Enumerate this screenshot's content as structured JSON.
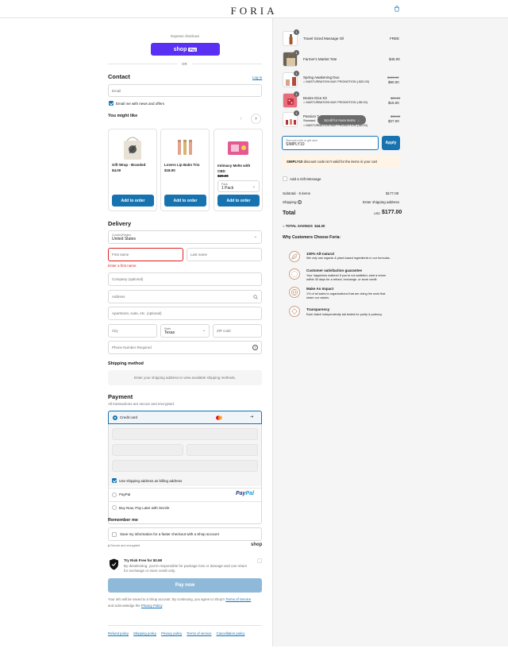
{
  "brand": {
    "logo": "FORIA"
  },
  "express": {
    "label": "Express checkout",
    "shop_pay_label": "shop",
    "shop_pay_badge": "Pay",
    "or": "OR"
  },
  "contact": {
    "title": "Contact",
    "login": "Log in",
    "email_placeholder": "Email",
    "news_label": "Email me with news and offers"
  },
  "upsell": {
    "title": "You might like",
    "items": [
      {
        "name": "Gift Wrap - Branded",
        "price": "$4.00",
        "button": "Add to order"
      },
      {
        "name": "Lovers Lip Balm Trio",
        "price": "$18.00",
        "button": "Add to order"
      },
      {
        "name": "Intimacy Melts with CBD",
        "price": "$20.00",
        "pack_label": "Pack",
        "pack_value": "1 Pack",
        "button": "Add to order"
      }
    ]
  },
  "delivery": {
    "title": "Delivery",
    "country_label": "Country/Region",
    "country_value": "United States",
    "first_name": "First name",
    "last_name": "Last name",
    "error": "Enter a first name",
    "company": "Company (optional)",
    "address": "Address",
    "apartment": "Apartment, suite, etc. (optional)",
    "city": "City",
    "state_label": "State",
    "state_value": "Texas",
    "zip": "ZIP code",
    "phone": "Phone Number Required"
  },
  "shipping": {
    "title": "Shipping method",
    "note": "Enter your shipping address to view available shipping methods."
  },
  "payment": {
    "title": "Payment",
    "subtitle": "All transactions are secure and encrypted.",
    "credit_card": "Credit card",
    "billing_same": "Use shipping address as billing address",
    "paypal": "PayPal",
    "paypal_logo_a": "Pay",
    "paypal_logo_b": "Pal",
    "sezzle": "Buy Now, Pay Later with Sezzle"
  },
  "remember": {
    "title": "Remember me",
    "label": "Save my information for a faster checkout with a Shop account",
    "secure": "Secure and encrypted",
    "shop": "shop"
  },
  "risk": {
    "title": "Try Risk Free for $0.98",
    "desc1": "By deselecting, you're responsible for package loss or damage and can return",
    "desc2": "for exchange or store credit only."
  },
  "pay_now": "Pay now",
  "legal": {
    "line1": "Your info will be saved to a Shop account. By continuing, you agree to Shop's",
    "terms": "Terms of Service",
    "line2": "and acknowledge the",
    "privacy": "Privacy Policy",
    "period": "."
  },
  "footer_links": [
    "Refund policy",
    "Shipping policy",
    "Privacy policy",
    "Terms of service",
    "Cancellation policy"
  ],
  "cart": {
    "items": [
      {
        "qty": "1",
        "name": "Travel Sized Massage Oil",
        "price": "FREE"
      },
      {
        "qty": "1",
        "name": "Farmer's Market Tote",
        "price": "$45.00"
      },
      {
        "qty": "1",
        "name": "Spring Awakening Duo",
        "discount": "MASTURBATION MAY PROMOTION (-$30.00)",
        "old_price": "$120.00",
        "price": "$90.00"
      },
      {
        "qty": "1",
        "name": "Desire Dice Kit",
        "discount": "MASTURBATION MAY PROMOTION (-$5.00)",
        "old_price": "$20.00",
        "price": "$15.00"
      },
      {
        "qty": "1",
        "name": "Passion T",
        "variant": "Standard",
        "discount": "MASTURBATION MAY PROMOTION (-$9.00)",
        "old_price": "$36.00",
        "price": "$27.00"
      }
    ],
    "scroll_pill": "Scroll for more items",
    "discount_label": "Discount code or gift card",
    "discount_value": "SIMPLY10",
    "apply": "Apply",
    "discount_error_code": "SIMPLY10",
    "discount_error_rest": "discount code isn't valid for the items in your cart",
    "gift_message": "Add a Gift Message",
    "subtotal_label": "Subtotal · 5 items",
    "subtotal_value": "$177.00",
    "shipping_label": "Shipping",
    "shipping_value": "Enter shipping address",
    "total_label": "Total",
    "currency": "USD",
    "total_value": "$177.00",
    "savings": "TOTAL SAVINGS  $44.00"
  },
  "why": {
    "title": "Why Customers Choose Foria:",
    "items": [
      {
        "title": "100% All-natural",
        "desc1": "We only use organic & plant-based ingredients in our formulas.",
        "desc2": ""
      },
      {
        "title": "Customer satisfaction guarantee",
        "desc1": "Your happiness matters! If you're not satisfied, start a return",
        "desc2": "within 30 days for a refund, exchange, or store credit."
      },
      {
        "title": "Make An Impact",
        "desc1": "1% of all sales to organizations that are doing the work that",
        "desc2": "share our values."
      },
      {
        "title": "Transparency",
        "desc1": "Each batch independently lab tested for purity & potency.",
        "desc2": ""
      }
    ]
  },
  "colors": {
    "accent": "#1773b0",
    "shop_pay": "#5a31f4",
    "error": "#dd1d1d",
    "error_bg": "#fff4e5"
  }
}
